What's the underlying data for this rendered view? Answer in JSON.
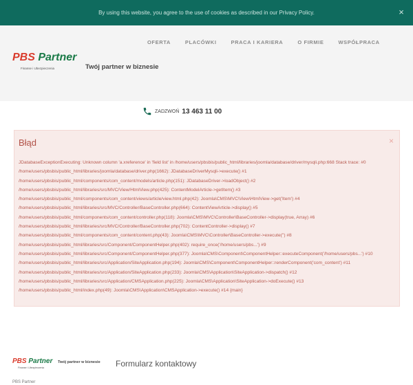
{
  "cookie_bar": {
    "text": "By using this website, you agree to the use of cookies as described in our Privacy Policy.",
    "close_glyph": "×"
  },
  "nav": {
    "items": [
      "OFERTA",
      "PLACÓWKI",
      "PRACA I KARIERA",
      "O FIRMIE",
      "WSPÓŁPRACA"
    ]
  },
  "brand": {
    "logo_pbs": "PBS",
    "logo_partner": "Partner",
    "logo_sub": "Finanse i Ubezpieczenia",
    "tagline": "Twój partner w biznesie",
    "colors": {
      "green": "#1a7a47",
      "red": "#d93b2c",
      "cookie_bg": "#0f6b5e"
    }
  },
  "phone": {
    "label": "ZADZWOŃ",
    "number": "13 463 11 00",
    "icon": "phone-icon"
  },
  "error": {
    "title": "Błąd",
    "close_glyph": "×",
    "message": "JDatabaseExceptionExecuting: Unknown column 'a.xreference' in 'field list' in /home/users/pbsbis/public_html/libraries/joomla/database/driver/mysqli.php:668 Stack trace: #0 /home/users/pbsbis/public_html/libraries/joomla/database/driver.php(1662): JDatabaseDriverMysqli->execute() #1 /home/users/pbsbis/public_html/components/com_content/models/article.php(151): JDatabaseDriver->loadObject() #2 /home/users/pbsbis/public_html/libraries/src/MVC/View/HtmlView.php(425): ContentModelArticle->getItem() #3 /home/users/pbsbis/public_html/components/com_content/views/article/view.html.php(42): Joomla\\CMS\\MVC\\View\\HtmlView->get('Item') #4 /home/users/pbsbis/public_html/libraries/src/MVC/Controller/BaseController.php(664): ContentViewArticle->display() #5 /home/users/pbsbis/public_html/components/com_content/controller.php(118): Joomla\\CMS\\MVC\\Controller\\BaseController->display(true, Array) #6 /home/users/pbsbis/public_html/libraries/src/MVC/Controller/BaseController.php(702): ContentController->display() #7 /home/users/pbsbis/public_html/components/com_content/content.php(43): Joomla\\CMS\\MVC\\Controller\\BaseController->execute('') #8 /home/users/pbsbis/public_html/libraries/src/Component/ComponentHelper.php(402): require_once('/home/users/pbs...') #9 /home/users/pbsbis/public_html/libraries/src/Component/ComponentHelper.php(377): Joomla\\CMS\\Component\\ComponentHelper::executeComponent('/home/users/pbs...') #10 /home/users/pbsbis/public_html/libraries/src/Application/SiteApplication.php(194): Joomla\\CMS\\Component\\ComponentHelper::renderComponent('com_content') #11 /home/users/pbsbis/public_html/libraries/src/Application/SiteApplication.php(233): Joomla\\CMS\\Application\\SiteApplication->dispatch() #12 /home/users/pbsbis/public_html/libraries/src/Application/CMSApplication.php(225): Joomla\\CMS\\Application\\SiteApplication->doExecute() #13 /home/users/pbsbis/public_html/index.php(49): Joomla\\CMS\\Application\\CMSApplication->execute() #14 {main}"
  },
  "footer": {
    "logo_pbs": "PBS",
    "logo_partner": "Partner",
    "logo_sub": "Finanse i Ubezpieczenia",
    "tagline": "Twój partner w biznesie",
    "form_title": "Formularz kontaktowy",
    "company": "PBS Partner"
  }
}
